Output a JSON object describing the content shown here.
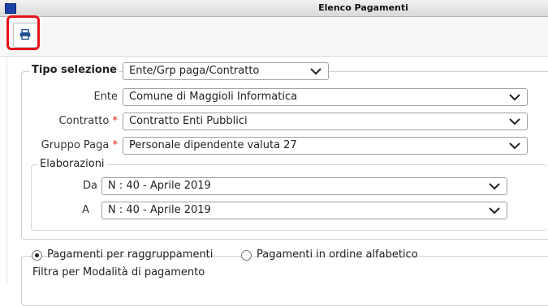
{
  "window": {
    "title": "Elenco Pagamenti"
  },
  "toolbar": {
    "print_icon": "printer-icon"
  },
  "selection": {
    "tipo_label": "Tipo selezione",
    "tipo_value": "Ente/Grp paga/Contratto",
    "ente_label": "Ente",
    "ente_value": "Comune di Maggioli Informatica",
    "contratto_label": "Contratto",
    "contratto_value": "Contratto Enti Pubblici",
    "gruppo_label": "Gruppo Paga",
    "gruppo_value": "Personale dipendente valuta 27",
    "required_mark": "*"
  },
  "elaborazioni": {
    "label": "Elaborazioni",
    "da_label": "Da",
    "da_value": "N : 40 - Aprile 2019",
    "a_label": "A",
    "a_value": "N : 40 - Aprile 2019"
  },
  "ordering": {
    "option1": "Pagamenti per raggruppamenti",
    "option2": "Pagamenti in ordine alfabetico",
    "selected": "option1"
  },
  "filter": {
    "label": "Filtra per Modalità di pagamento"
  },
  "colors": {
    "highlight": "#e5131b",
    "required": "#e21b1b"
  }
}
